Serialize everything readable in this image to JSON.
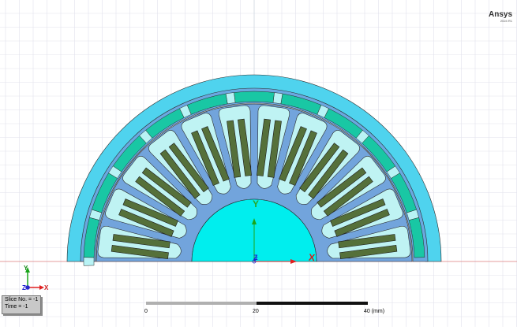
{
  "brand": {
    "name": "Ansys",
    "version": "2024 R1"
  },
  "axes": {
    "x_label": "X",
    "y_label": "Y",
    "z_label": "Z"
  },
  "triad": {
    "x": "X",
    "y": "Y",
    "z": "Z"
  },
  "status": {
    "slice_line": "Slice No. = -1",
    "time_line": "Time = -1"
  },
  "scale_bar": {
    "tick_0": "0",
    "tick_20": "20",
    "tick_40": "40 (mm)"
  },
  "model": {
    "slot_count": 12,
    "colors": {
      "background": "#ffffff",
      "grid": "#e1e1ec",
      "stator_yoke": "#4fd3ee",
      "stator_back_ring": "#6aa8e0",
      "magnet": "#19c7a4",
      "magnet_gap": "#b8f3f5",
      "rotor_core": "#72a4dc",
      "slot": "#bff3f3",
      "coil": "#55703a",
      "shaft": "#00eeee",
      "axis_line": "#e08080",
      "x_axis": "#e02020",
      "y_axis": "#1aa51a",
      "z_axis": "#2020d0"
    }
  }
}
